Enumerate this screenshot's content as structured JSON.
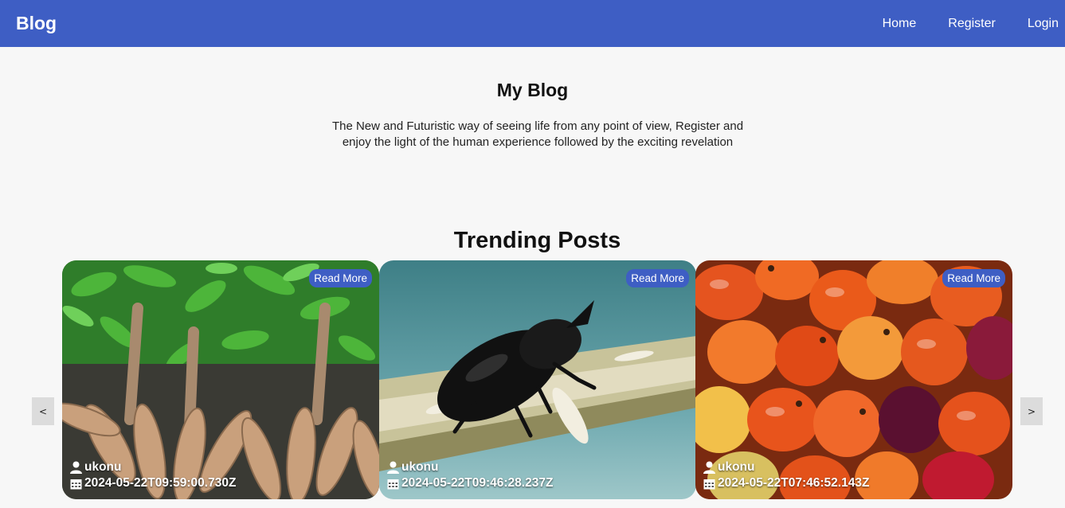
{
  "navbar": {
    "brand": "Blog",
    "links": [
      "Home",
      "Register",
      "Login"
    ]
  },
  "hero": {
    "title": "My Blog",
    "description": "The New and Futuristic way of seeing life from any point of view, Register and enjoy the light of the human experience followed by the exciting revelation"
  },
  "trending": {
    "title": "Trending Posts",
    "prev_label": "<",
    "next_label": ">",
    "posts": [
      {
        "read_more": "Read More",
        "author": "ukonu",
        "date": "2024-05-22T09:59:00.730Z",
        "image": "cassava-roots-photo"
      },
      {
        "read_more": "Read More",
        "author": "ukonu",
        "date": "2024-05-22T09:46:28.237Z",
        "image": "black-beetle-photo"
      },
      {
        "read_more": "Read More",
        "author": "ukonu",
        "date": "2024-05-22T07:46:52.143Z",
        "image": "palm-fruits-photo"
      }
    ]
  },
  "colors": {
    "navbar": "#3e5ec4",
    "background": "#f7f7f7",
    "read_more": "#3e5ec4"
  }
}
